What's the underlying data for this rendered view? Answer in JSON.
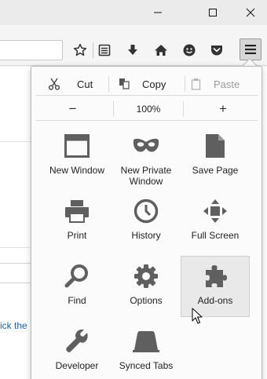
{
  "window": {
    "buttons": [
      {
        "name": "minimize",
        "icon": "minimize-icon"
      },
      {
        "name": "maximize",
        "icon": "maximize-icon"
      },
      {
        "name": "close",
        "icon": "close-icon"
      }
    ]
  },
  "toolbar": {
    "icons": [
      "bookmark-star-icon",
      "reading-list-icon",
      "downloads-icon",
      "home-icon",
      "hello-icon",
      "pocket-icon",
      "menu-icon"
    ],
    "accent_pocket": "#555555"
  },
  "content": {
    "link_fragment": "ick the"
  },
  "panel": {
    "edit": {
      "cut": "Cut",
      "copy": "Copy",
      "paste": "Paste"
    },
    "zoom": {
      "minus": "−",
      "value": "100%",
      "plus": "+"
    },
    "items": [
      {
        "label": "New Window",
        "icon": "new-window-icon"
      },
      {
        "label": "New Private\nWindow",
        "icon": "private-mask-icon"
      },
      {
        "label": "Save Page",
        "icon": "save-page-icon"
      },
      {
        "label": "Print",
        "icon": "printer-icon"
      },
      {
        "label": "History",
        "icon": "clock-icon"
      },
      {
        "label": "Full Screen",
        "icon": "full-screen-icon"
      },
      {
        "label": "Find",
        "icon": "magnifier-icon"
      },
      {
        "label": "Options",
        "icon": "gear-icon"
      },
      {
        "label": "Add-ons",
        "icon": "puzzle-piece-icon"
      },
      {
        "label": "Developer",
        "icon": "wrench-icon"
      },
      {
        "label": "Synced Tabs",
        "icon": "synced-tabs-icon"
      }
    ],
    "hovered_item": "Add-ons"
  },
  "colors": {
    "icon_gray": "#5f5f5f",
    "disabled_gray": "#9b9b9b",
    "link_blue": "#1862b4"
  }
}
